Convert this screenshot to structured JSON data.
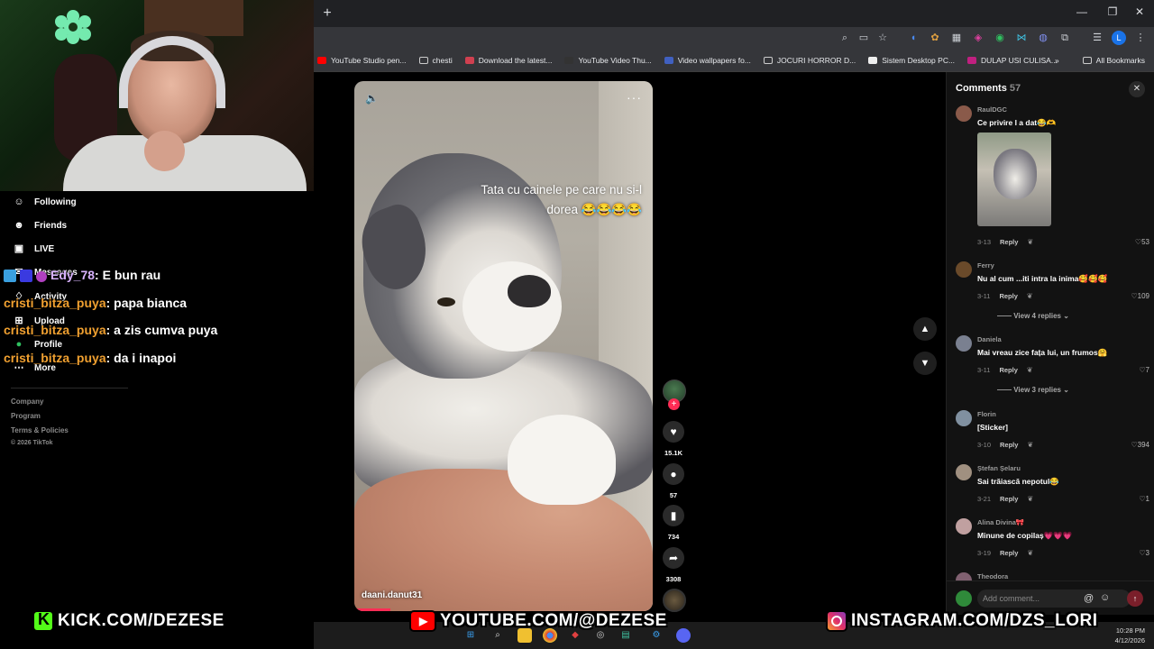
{
  "browser": {
    "new_tab_symbol": "+",
    "window_controls": [
      "—",
      "❐",
      "✕"
    ],
    "bookmarks": [
      {
        "label": "YouTube Studio pen...",
        "color": "#ff0000"
      },
      {
        "label": "chesti",
        "color": "folder"
      },
      {
        "label": "Download the latest...",
        "color": "#d04050"
      },
      {
        "label": "YouTube Video Thu...",
        "color": "#333333"
      },
      {
        "label": "Video wallpapers fo...",
        "color": "#4060c0"
      },
      {
        "label": "JOCURI HORROR D...",
        "color": "folder"
      },
      {
        "label": "Sistem Desktop PC...",
        "color": "#eeeeee"
      },
      {
        "label": "DULAP USI CULISA...",
        "color": "#c02080"
      }
    ],
    "bookmarks_overflow": "»",
    "all_bookmarks": "All Bookmarks",
    "profile_initial": "L"
  },
  "sidebar": {
    "items": [
      {
        "label": "Following",
        "icon": "following-icon",
        "glyph": "☺"
      },
      {
        "label": "Friends",
        "icon": "friends-icon",
        "glyph": "☻"
      },
      {
        "label": "LIVE",
        "icon": "live-icon",
        "glyph": "▣"
      },
      {
        "label": "Messages",
        "icon": "messages-icon",
        "glyph": "✉"
      },
      {
        "label": "Activity",
        "icon": "activity-icon",
        "glyph": "♢"
      },
      {
        "label": "Upload",
        "icon": "upload-icon",
        "glyph": "⊞"
      },
      {
        "label": "Profile",
        "icon": "profile-icon",
        "glyph": "●"
      },
      {
        "label": "More",
        "icon": "more-icon",
        "glyph": "⋯"
      }
    ],
    "footer": [
      "Company",
      "Program",
      "Terms & Policies",
      "© 2026 TikTok"
    ]
  },
  "chat": [
    {
      "user": "Edy_78",
      "message": "E bun rau",
      "color": "#d9b3ff"
    },
    {
      "user": "cristi_bitza_puya",
      "message": "papa bianca",
      "color": "#f0a030"
    },
    {
      "user": "cristi_bitza_puya",
      "message": "a zis cumva puya",
      "color": "#f0a030"
    },
    {
      "user": "cristi_bitza_puya",
      "message": "da i inapoi",
      "color": "#f0a030"
    }
  ],
  "video": {
    "caption": "Tata cu cainele pe care nu si-l dorea 😂😂😂😂",
    "author": "daani.danut31",
    "sound_icon": "sound-icon",
    "more_icon": "more-options-icon"
  },
  "actions": {
    "likes": "15.1K",
    "comments": "57",
    "saves": "734",
    "shares": "3308"
  },
  "comments_panel": {
    "title": "Comments",
    "count": "57",
    "input_placeholder": "Add comment...",
    "reply_label": "Reply",
    "items": [
      {
        "user": "RaulDGC",
        "text": "Ce privire I a dat😂🫶",
        "date": "3-13",
        "likes": "53",
        "avatar": "#8a5a4a",
        "has_image": true
      },
      {
        "user": "Ferry",
        "text": "Nu al cum ...iti intra la inima🥰🥰🥰",
        "date": "3-11",
        "likes": "109",
        "avatar": "#6a4a2a",
        "view_replies": "View 4 replies"
      },
      {
        "user": "Daniela",
        "text": "Mai vreau zice fața lui, un frumos🤗",
        "date": "3-11",
        "likes": "7",
        "avatar": "#7a8090",
        "view_replies": "View 3 replies"
      },
      {
        "user": "Florin",
        "text": "[Sticker]",
        "date": "3-10",
        "likes": "394",
        "avatar": "#8090a0"
      },
      {
        "user": "Ștefan Șelaru",
        "text": "Sai trăiască nepotul😂",
        "date": "3-21",
        "likes": "1",
        "avatar": "#a09080"
      },
      {
        "user": "Alina Divina🎀",
        "text": "Minune de copilaș💗💗💗",
        "date": "3-19",
        "likes": "3",
        "avatar": "#c0a0a0"
      },
      {
        "user": "Theodora",
        "text": "",
        "date": "",
        "likes": "",
        "avatar": "#806070"
      }
    ]
  },
  "banners": {
    "kick": "KICK.COM/DEZESE",
    "youtube": "YOUTUBE.COM/@DEZESE",
    "instagram": "INSTAGRAM.COM/DZS_LORI"
  },
  "taskbar": {
    "time": "10:28 PM",
    "date": "4/12/2026"
  }
}
